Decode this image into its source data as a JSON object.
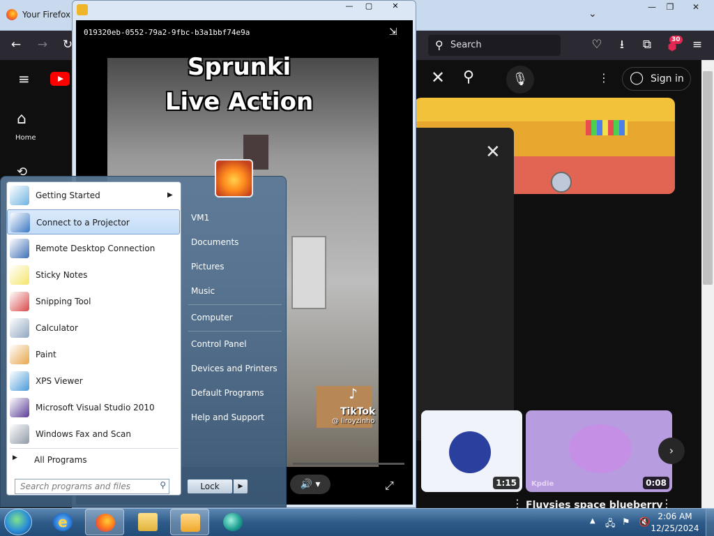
{
  "firefox": {
    "window_title": "Your Firefox n",
    "search_label": "Search",
    "extension_badge": "30"
  },
  "youtube": {
    "home_label": "Home",
    "sign_in": "Sign in",
    "thumb1_duration": "1:15",
    "thumb2_duration": "0:08",
    "video_title": "Fluvsies space blueberry",
    "thumb2_channel": "Kpdie"
  },
  "media_player": {
    "guid": "019320eb-0552-79a2-9fbc-b3a1bbf74e9a",
    "caption_line1": "Sprunki",
    "caption_line2": "Live Action",
    "tiktok_brand": "TikTok",
    "tiktok_user": "@ liroyzinho"
  },
  "start_menu": {
    "programs": [
      {
        "label": "Getting Started",
        "icon": "getting-started-icon",
        "color": "#6fb3e0"
      },
      {
        "label": "Connect to a Projector",
        "icon": "projector-icon",
        "color": "#3b78c4"
      },
      {
        "label": "Remote Desktop Connection",
        "icon": "remote-desktop-icon",
        "color": "#3d6fb6"
      },
      {
        "label": "Sticky Notes",
        "icon": "sticky-notes-icon",
        "color": "#f5e56b"
      },
      {
        "label": "Snipping Tool",
        "icon": "scissors-icon",
        "color": "#d94a4a"
      },
      {
        "label": "Calculator",
        "icon": "calculator-icon",
        "color": "#8fa6bf"
      },
      {
        "label": "Paint",
        "icon": "paint-palette-icon",
        "color": "#e7a64a"
      },
      {
        "label": "XPS Viewer",
        "icon": "xps-viewer-icon",
        "color": "#4a9bd9"
      },
      {
        "label": "Microsoft Visual Studio 2010",
        "icon": "visual-studio-icon",
        "color": "#5b3c96"
      },
      {
        "label": "Windows Fax and Scan",
        "icon": "fax-scanner-icon",
        "color": "#8f9aa6"
      }
    ],
    "all_programs": "All Programs",
    "search_placeholder": "Search programs and files",
    "right_links": [
      "VM1",
      "Documents",
      "Pictures",
      "Music",
      "Computer",
      "Control Panel",
      "Devices and Printers",
      "Default Programs",
      "Help and Support"
    ],
    "lock_label": "Lock"
  },
  "taskbar": {
    "time": "2:06 AM",
    "date": "12/25/2024"
  },
  "colors": {
    "taskbar_accent": "#2e5b8a",
    "youtube_red": "#ff0000",
    "firefox_toolbar": "#2b2a33"
  }
}
